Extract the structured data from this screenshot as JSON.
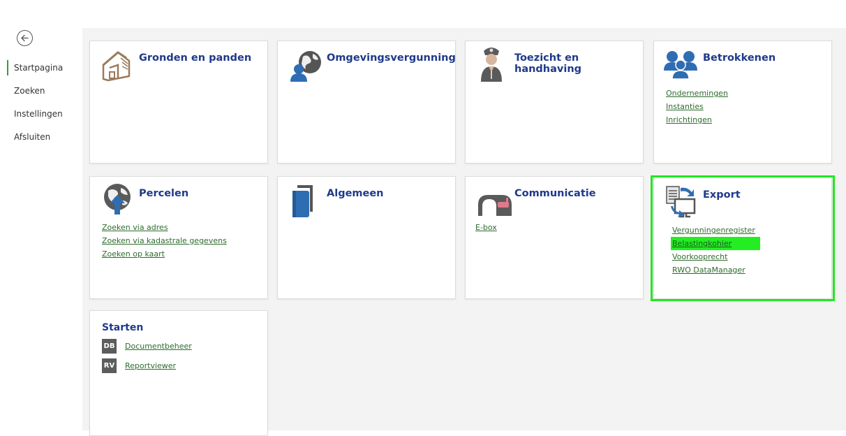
{
  "sidebar": {
    "back_icon": "arrow-left-circle-icon",
    "items": [
      {
        "label": "Startpagina",
        "active": true
      },
      {
        "label": "Zoeken"
      },
      {
        "label": "Instellingen"
      },
      {
        "label": "Afsluiten"
      }
    ]
  },
  "tiles": {
    "gronden": {
      "title": "Gronden en panden",
      "icon": "house-icon"
    },
    "omgevingsvergunning": {
      "title": "Omgevingsvergunning",
      "icon": "globe-person-icon"
    },
    "toezicht": {
      "title": "Toezicht en handhaving",
      "icon": "police-officer-icon"
    },
    "betrokkenen": {
      "title": "Betrokkenen",
      "icon": "people-group-icon",
      "links": [
        "Ondernemingen",
        "Instanties",
        "Inrichtingen"
      ]
    },
    "percelen": {
      "title": "Percelen",
      "icon": "globe-arrow-icon",
      "links": [
        "Zoeken via adres",
        "Zoeken via kadastrale gegevens",
        "Zoeken op kaart"
      ]
    },
    "algemeen": {
      "title": "Algemeen",
      "icon": "binder-icon"
    },
    "communicatie": {
      "title": "Communicatie",
      "icon": "mailbox-icon",
      "links": [
        "E-box"
      ]
    },
    "export": {
      "title": "Export",
      "icon": "export-monitor-icon",
      "links": [
        "Vergunningenregister",
        "Belastingkohier",
        "Voorkooprecht",
        "RWO DataManager"
      ]
    },
    "starten": {
      "title": "Starten",
      "items": [
        {
          "badge": "DB",
          "label": "Documentbeheer"
        },
        {
          "badge": "RV",
          "label": "Reportviewer"
        }
      ]
    }
  },
  "colors": {
    "title": "#1f3a8a",
    "link": "#2e6b2e",
    "highlight": "#22e822",
    "accent": "#3a9a3a"
  }
}
